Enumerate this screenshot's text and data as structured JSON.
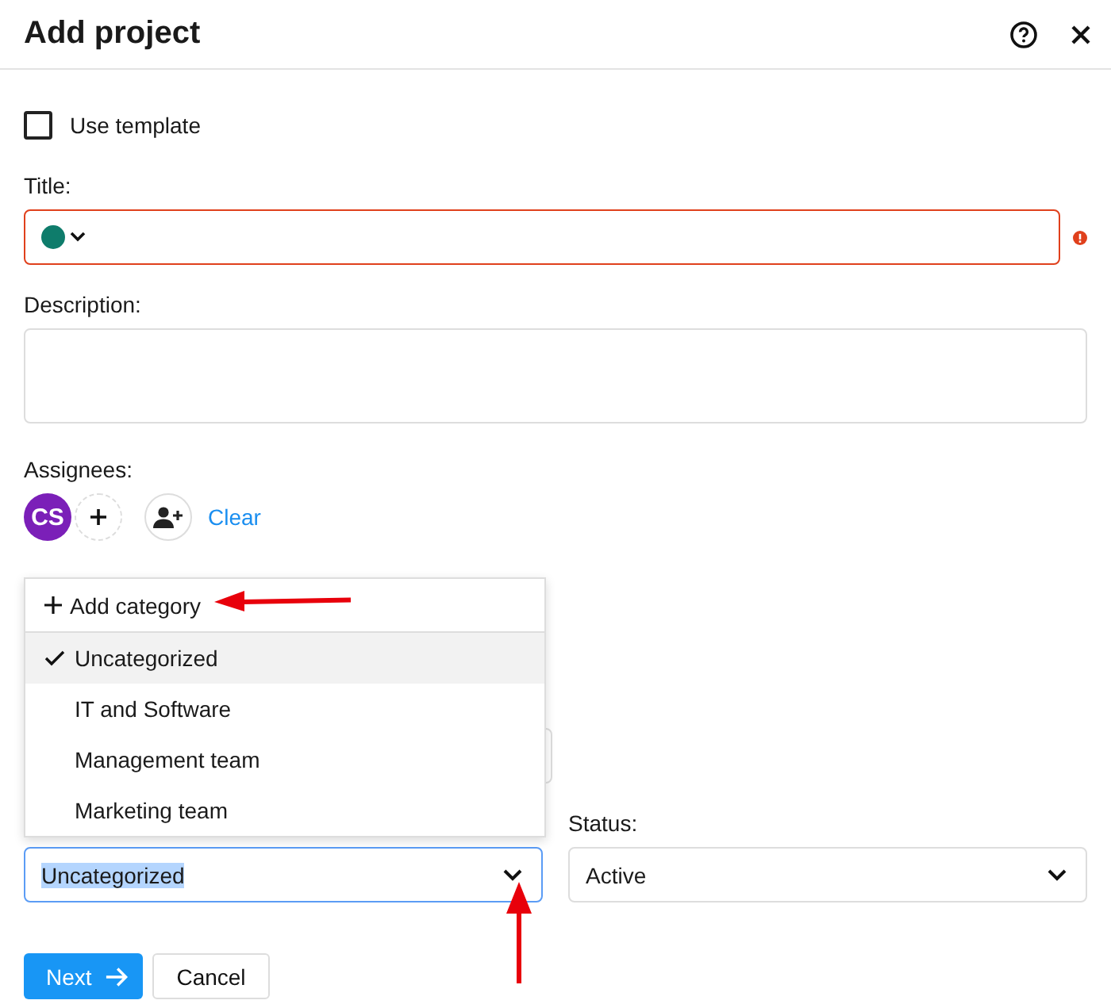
{
  "header": {
    "title": "Add project"
  },
  "use_template": {
    "label": "Use template",
    "checked": false
  },
  "title_field": {
    "label": "Title:",
    "color": "#0e7c6b",
    "invalid": true
  },
  "description": {
    "label": "Description:"
  },
  "assignees": {
    "label": "Assignees:",
    "avatars": [
      {
        "initials": "CS",
        "color": "#7b1fb8"
      }
    ],
    "clear_link": "Clear"
  },
  "category_menu": {
    "add_label": "Add category",
    "options": [
      {
        "label": "Uncategorized",
        "selected": true
      },
      {
        "label": "IT and Software",
        "selected": false
      },
      {
        "label": "Management team",
        "selected": false
      },
      {
        "label": "Marketing team",
        "selected": false
      }
    ]
  },
  "category_select": {
    "value": "Uncategorized",
    "text_selected": true
  },
  "status": {
    "label": "Status:",
    "value": "Active"
  },
  "buttons": [
    {
      "label": "Next",
      "kind": "primary"
    },
    {
      "label": "Cancel",
      "kind": "secondary"
    }
  ]
}
